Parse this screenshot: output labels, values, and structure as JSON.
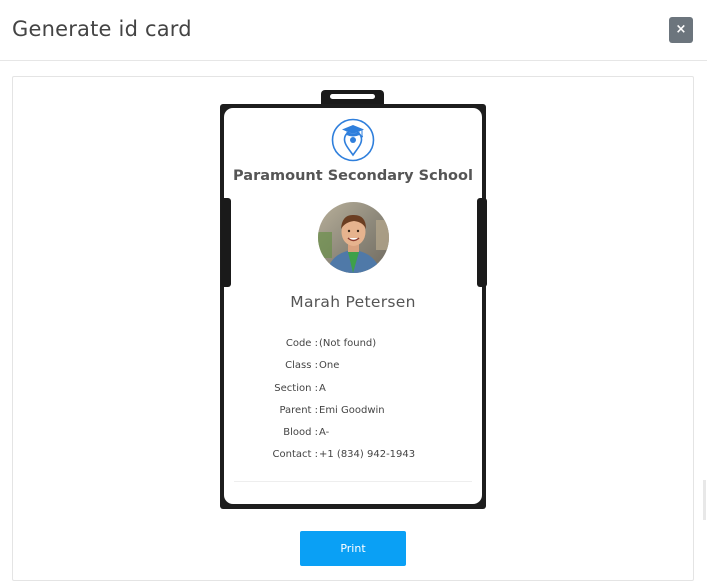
{
  "modal": {
    "title": "Generate id card",
    "close_label": "×"
  },
  "card": {
    "school_name": "Paramount Secondary School",
    "student_name": "Marah Petersen",
    "fields": [
      {
        "label": "Code :",
        "value": "(Not found)"
      },
      {
        "label": "Class :",
        "value": "One"
      },
      {
        "label": "Section :",
        "value": "A"
      },
      {
        "label": "Parent :",
        "value": "Emi Goodwin"
      },
      {
        "label": "Blood :",
        "value": "A-"
      },
      {
        "label": "Contact :",
        "value": "+1 (834) 942-1943"
      }
    ],
    "logo_icon": "graduation-cap-location-pin-icon",
    "accent_color": "#0aa0f5"
  },
  "actions": {
    "print_label": "Print"
  }
}
